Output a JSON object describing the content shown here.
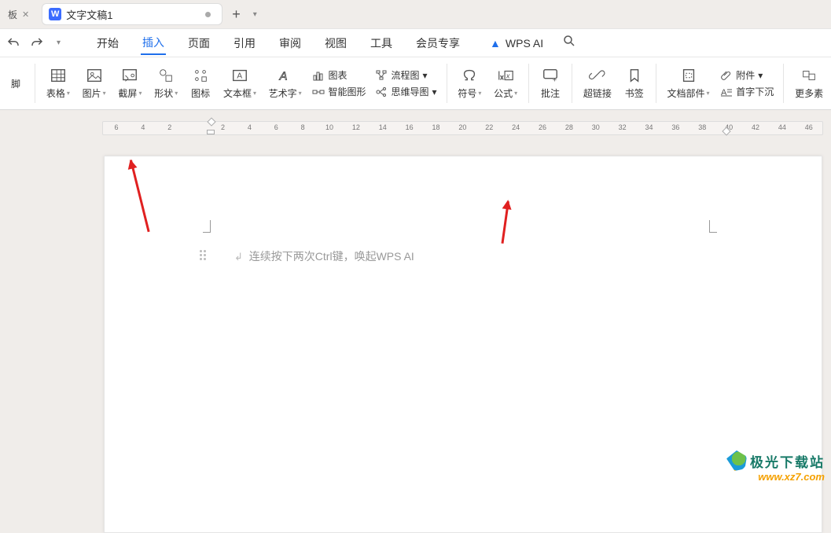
{
  "tabs": {
    "stub_label": "板",
    "doc_icon": "W",
    "doc_title": "文字文稿1"
  },
  "menu": {
    "items": [
      "开始",
      "插入",
      "页面",
      "引用",
      "审阅",
      "视图",
      "工具",
      "会员专享"
    ],
    "active_index": 1,
    "ai_label": "WPS AI"
  },
  "ribbon": {
    "footer_stub": "脚",
    "table": "表格",
    "picture": "图片",
    "screenshot": "截屏",
    "shape": "形状",
    "icon": "图标",
    "textbox": "文本框",
    "wordart": "艺术字",
    "chart": "图表",
    "smart_graphic": "智能图形",
    "flowchart": "流程图",
    "mindmap": "思维导图",
    "symbol": "符号",
    "equation": "公式",
    "comment": "批注",
    "hyperlink": "超链接",
    "bookmark": "书签",
    "doc_parts": "文档部件",
    "attachment": "附件",
    "dropcap": "首字下沉",
    "more": "更多素"
  },
  "ruler": {
    "left": [
      "6",
      "4",
      "2"
    ],
    "right": [
      "2",
      "4",
      "6",
      "8",
      "10",
      "12",
      "14",
      "16",
      "18",
      "20",
      "22",
      "24",
      "26",
      "28",
      "30",
      "32",
      "34",
      "36",
      "38",
      "40",
      "42",
      "44",
      "46"
    ]
  },
  "page": {
    "placeholder": "连续按下两次Ctrl键，唤起WPS AI"
  },
  "watermark": {
    "title": "极光下载站",
    "url": "www.xz7.com"
  }
}
